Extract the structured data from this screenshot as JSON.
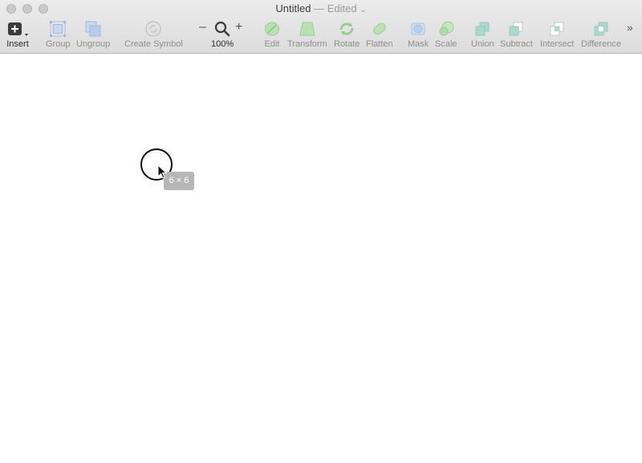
{
  "window": {
    "title": "Untitled",
    "separator": "—",
    "status": "Edited",
    "status_chevron": "⌄"
  },
  "toolbar": {
    "insert": {
      "label": "Insert",
      "icon": "plus-box-icon"
    },
    "group": {
      "label": "Group",
      "icon": "group-icon"
    },
    "ungroup": {
      "label": "Ungroup",
      "icon": "ungroup-icon"
    },
    "create_symbol": {
      "label": "Create Symbol",
      "icon": "symbol-icon"
    },
    "zoom": {
      "label": "100%",
      "minus": "–",
      "plus": "+",
      "icon": "magnifier-icon"
    },
    "edit": {
      "label": "Edit",
      "icon": "pen-edit-icon"
    },
    "transform": {
      "label": "Transform",
      "icon": "transform-icon"
    },
    "rotate": {
      "label": "Rotate",
      "icon": "rotate-icon"
    },
    "flatten": {
      "label": "Flatten",
      "icon": "flatten-icon"
    },
    "mask": {
      "label": "Mask",
      "icon": "mask-icon"
    },
    "scale": {
      "label": "Scale",
      "icon": "scale-icon"
    },
    "union": {
      "label": "Union",
      "icon": "union-icon"
    },
    "subtract": {
      "label": "Subtract",
      "icon": "subtract-icon"
    },
    "intersect": {
      "label": "Intersect",
      "icon": "intersect-icon"
    },
    "difference": {
      "label": "Difference",
      "icon": "difference-icon"
    },
    "overflow": {
      "label": "»"
    }
  },
  "canvas": {
    "size_tooltip": "6 × 6"
  },
  "colors": {
    "toolbar_bg": "#dcdcdc",
    "disabled_icon_green": "#9fd69a",
    "disabled_icon_blue": "#a9c4e6",
    "canvas_bg": "#ffffff"
  }
}
